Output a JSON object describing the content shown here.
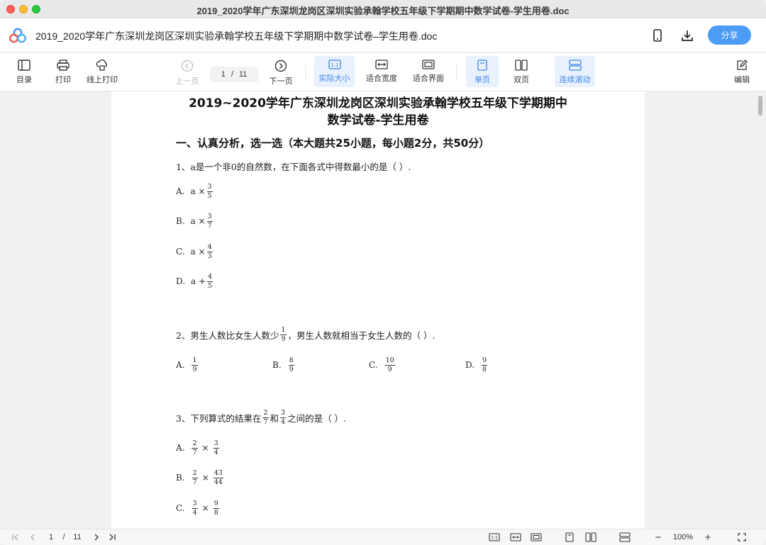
{
  "window": {
    "title": "2019_2020学年广东深圳龙岗区深圳实验承翰学校五年级下学期期中数学试卷-学生用卷.doc"
  },
  "header": {
    "doc_title": "2019_2020学年广东深圳龙岗区深圳实验承翰学校五年级下学期期中数学试卷–学生用卷.doc",
    "share_label": "分享",
    "icons": [
      "mobile-icon",
      "download-icon"
    ]
  },
  "toolbar": {
    "toc": "目录",
    "print": "打印",
    "online_print": "线上打印",
    "prev_page": "上一页",
    "page_current": "1",
    "page_sep": "/",
    "page_total": "11",
    "next_page": "下一页",
    "actual_size": "实际大小",
    "fit_width": "适合宽度",
    "fit_screen": "适合界面",
    "single_page": "单页",
    "double_page": "双页",
    "continuous_scroll": "连续滚动",
    "edit": "编辑"
  },
  "document": {
    "title_line1": "2019~2020学年广东深圳龙岗区深圳实验承翰学校五年级下学期期中",
    "title_line2": "数学试卷-学生用卷",
    "section1": "一、认真分析，选一选（本大题共25小题，每小题2分，共50分）",
    "q1": {
      "stem": "1、a是一个非0的自然数，在下面各式中得数最小的是（    ）.",
      "options": [
        {
          "letter": "A.",
          "expr": "a  ×",
          "num": "3",
          "den": "5"
        },
        {
          "letter": "B.",
          "expr": "a  ×",
          "num": "3",
          "den": "7"
        },
        {
          "letter": "C.",
          "expr": "a  ×",
          "num": "4",
          "den": "3"
        },
        {
          "letter": "D.",
          "expr": "a  +",
          "num": "4",
          "den": "5"
        }
      ]
    },
    "q2": {
      "stem_a": "2、男生人数比女生人数少",
      "stem_num": "1",
      "stem_den": "9",
      "stem_b": "，男生人数就相当于女生人数的（    ）.",
      "options": [
        {
          "letter": "A.",
          "num": "1",
          "den": "9"
        },
        {
          "letter": "B.",
          "num": "8",
          "den": "9"
        },
        {
          "letter": "C.",
          "num": "10",
          "den": "9"
        },
        {
          "letter": "D.",
          "num": "9",
          "den": "8"
        }
      ]
    },
    "q3": {
      "stem_a": "3、下列算式的结果在",
      "f1_num": "2",
      "f1_den": "7",
      "stem_mid": "和",
      "f2_num": "3",
      "f2_den": "4",
      "stem_b": "之间的是（    ）.",
      "options": [
        {
          "letter": "A.",
          "a_num": "2",
          "a_den": "7",
          "op": "×",
          "b_num": "3",
          "b_den": "4"
        },
        {
          "letter": "B.",
          "a_num": "2",
          "a_den": "7",
          "op": "×",
          "b_num": "43",
          "b_den": "44"
        },
        {
          "letter": "C.",
          "a_num": "3",
          "a_den": "4",
          "op": "×",
          "b_num": "9",
          "b_den": "8"
        }
      ]
    }
  },
  "statusbar": {
    "page_current": "1",
    "page_sep": "/",
    "page_total": "11",
    "zoom": "100%",
    "zoom_out": "−",
    "zoom_in": "+"
  },
  "colors": {
    "accent": "#4c9bf5",
    "active_bg": "#e8f1fd",
    "active_text": "#3e86e8"
  }
}
